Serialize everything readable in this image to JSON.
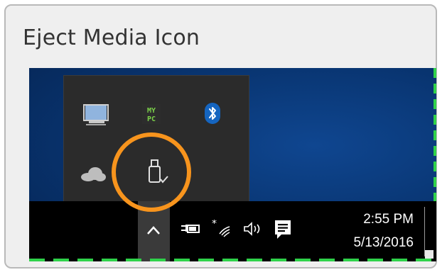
{
  "title": "Eject Media Icon",
  "tray": {
    "icons": [
      {
        "name": "laptop-icon"
      },
      {
        "name": "mypc-icon",
        "text_line1": "MY",
        "text_line2": "PC"
      },
      {
        "name": "bluetooth-icon",
        "glyph": "✱"
      },
      {
        "name": "onedrive-cloud-icon"
      },
      {
        "name": "usb-eject-icon"
      }
    ]
  },
  "taskbar": {
    "chevron_glyph": "^",
    "time": "2:55 PM",
    "date": "5/13/2016"
  },
  "colors": {
    "highlight_ring": "#f7941d",
    "dash_border": "#2fd24a",
    "desktop": "#08336e"
  }
}
